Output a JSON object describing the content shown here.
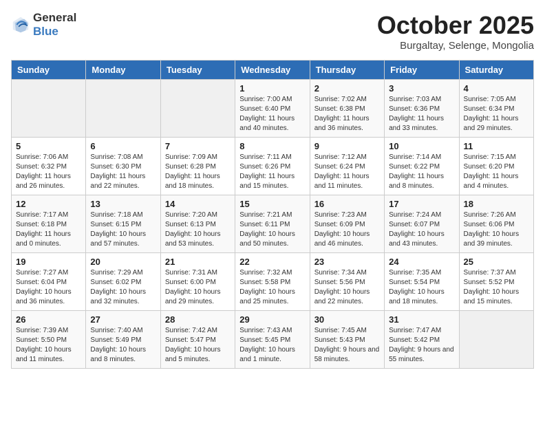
{
  "header": {
    "logo_general": "General",
    "logo_blue": "Blue",
    "month_title": "October 2025",
    "subtitle": "Burgaltay, Selenge, Mongolia"
  },
  "weekdays": [
    "Sunday",
    "Monday",
    "Tuesday",
    "Wednesday",
    "Thursday",
    "Friday",
    "Saturday"
  ],
  "weeks": [
    [
      {
        "day": "",
        "info": ""
      },
      {
        "day": "",
        "info": ""
      },
      {
        "day": "",
        "info": ""
      },
      {
        "day": "1",
        "info": "Sunrise: 7:00 AM\nSunset: 6:40 PM\nDaylight: 11 hours and 40 minutes."
      },
      {
        "day": "2",
        "info": "Sunrise: 7:02 AM\nSunset: 6:38 PM\nDaylight: 11 hours and 36 minutes."
      },
      {
        "day": "3",
        "info": "Sunrise: 7:03 AM\nSunset: 6:36 PM\nDaylight: 11 hours and 33 minutes."
      },
      {
        "day": "4",
        "info": "Sunrise: 7:05 AM\nSunset: 6:34 PM\nDaylight: 11 hours and 29 minutes."
      }
    ],
    [
      {
        "day": "5",
        "info": "Sunrise: 7:06 AM\nSunset: 6:32 PM\nDaylight: 11 hours and 26 minutes."
      },
      {
        "day": "6",
        "info": "Sunrise: 7:08 AM\nSunset: 6:30 PM\nDaylight: 11 hours and 22 minutes."
      },
      {
        "day": "7",
        "info": "Sunrise: 7:09 AM\nSunset: 6:28 PM\nDaylight: 11 hours and 18 minutes."
      },
      {
        "day": "8",
        "info": "Sunrise: 7:11 AM\nSunset: 6:26 PM\nDaylight: 11 hours and 15 minutes."
      },
      {
        "day": "9",
        "info": "Sunrise: 7:12 AM\nSunset: 6:24 PM\nDaylight: 11 hours and 11 minutes."
      },
      {
        "day": "10",
        "info": "Sunrise: 7:14 AM\nSunset: 6:22 PM\nDaylight: 11 hours and 8 minutes."
      },
      {
        "day": "11",
        "info": "Sunrise: 7:15 AM\nSunset: 6:20 PM\nDaylight: 11 hours and 4 minutes."
      }
    ],
    [
      {
        "day": "12",
        "info": "Sunrise: 7:17 AM\nSunset: 6:18 PM\nDaylight: 11 hours and 0 minutes."
      },
      {
        "day": "13",
        "info": "Sunrise: 7:18 AM\nSunset: 6:15 PM\nDaylight: 10 hours and 57 minutes."
      },
      {
        "day": "14",
        "info": "Sunrise: 7:20 AM\nSunset: 6:13 PM\nDaylight: 10 hours and 53 minutes."
      },
      {
        "day": "15",
        "info": "Sunrise: 7:21 AM\nSunset: 6:11 PM\nDaylight: 10 hours and 50 minutes."
      },
      {
        "day": "16",
        "info": "Sunrise: 7:23 AM\nSunset: 6:09 PM\nDaylight: 10 hours and 46 minutes."
      },
      {
        "day": "17",
        "info": "Sunrise: 7:24 AM\nSunset: 6:07 PM\nDaylight: 10 hours and 43 minutes."
      },
      {
        "day": "18",
        "info": "Sunrise: 7:26 AM\nSunset: 6:06 PM\nDaylight: 10 hours and 39 minutes."
      }
    ],
    [
      {
        "day": "19",
        "info": "Sunrise: 7:27 AM\nSunset: 6:04 PM\nDaylight: 10 hours and 36 minutes."
      },
      {
        "day": "20",
        "info": "Sunrise: 7:29 AM\nSunset: 6:02 PM\nDaylight: 10 hours and 32 minutes."
      },
      {
        "day": "21",
        "info": "Sunrise: 7:31 AM\nSunset: 6:00 PM\nDaylight: 10 hours and 29 minutes."
      },
      {
        "day": "22",
        "info": "Sunrise: 7:32 AM\nSunset: 5:58 PM\nDaylight: 10 hours and 25 minutes."
      },
      {
        "day": "23",
        "info": "Sunrise: 7:34 AM\nSunset: 5:56 PM\nDaylight: 10 hours and 22 minutes."
      },
      {
        "day": "24",
        "info": "Sunrise: 7:35 AM\nSunset: 5:54 PM\nDaylight: 10 hours and 18 minutes."
      },
      {
        "day": "25",
        "info": "Sunrise: 7:37 AM\nSunset: 5:52 PM\nDaylight: 10 hours and 15 minutes."
      }
    ],
    [
      {
        "day": "26",
        "info": "Sunrise: 7:39 AM\nSunset: 5:50 PM\nDaylight: 10 hours and 11 minutes."
      },
      {
        "day": "27",
        "info": "Sunrise: 7:40 AM\nSunset: 5:49 PM\nDaylight: 10 hours and 8 minutes."
      },
      {
        "day": "28",
        "info": "Sunrise: 7:42 AM\nSunset: 5:47 PM\nDaylight: 10 hours and 5 minutes."
      },
      {
        "day": "29",
        "info": "Sunrise: 7:43 AM\nSunset: 5:45 PM\nDaylight: 10 hours and 1 minute."
      },
      {
        "day": "30",
        "info": "Sunrise: 7:45 AM\nSunset: 5:43 PM\nDaylight: 9 hours and 58 minutes."
      },
      {
        "day": "31",
        "info": "Sunrise: 7:47 AM\nSunset: 5:42 PM\nDaylight: 9 hours and 55 minutes."
      },
      {
        "day": "",
        "info": ""
      }
    ]
  ]
}
